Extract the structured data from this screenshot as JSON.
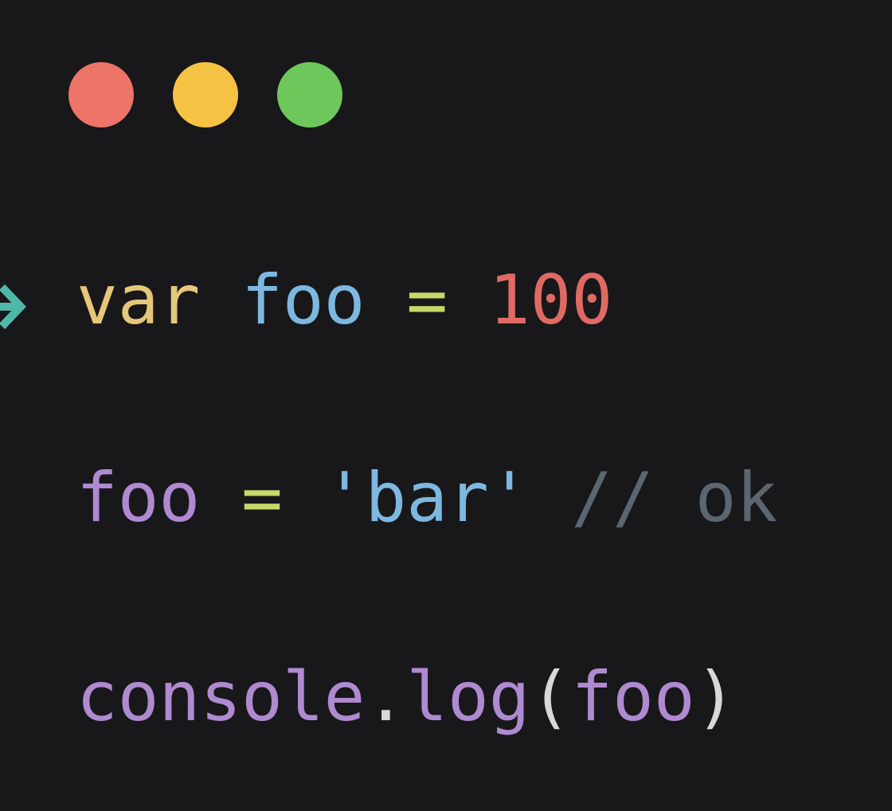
{
  "colors": {
    "background": "#18181b",
    "red_light": "#ec7468",
    "yellow_light": "#f6c244",
    "green_light": "#6ec75a",
    "keyword": "#e6c77a",
    "identifier": "#7db8e0",
    "operator": "#c8d86a",
    "number": "#e06a63",
    "variable": "#b08ad0",
    "string": "#7db8e0",
    "comment": "#5b6670",
    "punctuation": "#d8d8d8",
    "arrow": "#4fb8a8"
  },
  "icons": {
    "arrow": "arrow-right-icon"
  },
  "code": {
    "line1": {
      "keyword": "var",
      "identifier": "foo",
      "operator": "=",
      "number": "100"
    },
    "line2": {
      "variable": "foo",
      "operator": "=",
      "string": "'bar'",
      "comment": "// ok"
    },
    "line3": {
      "object": "console",
      "dot": ".",
      "method": "log",
      "open_paren": "(",
      "argument": "foo",
      "close_paren": ")"
    }
  }
}
